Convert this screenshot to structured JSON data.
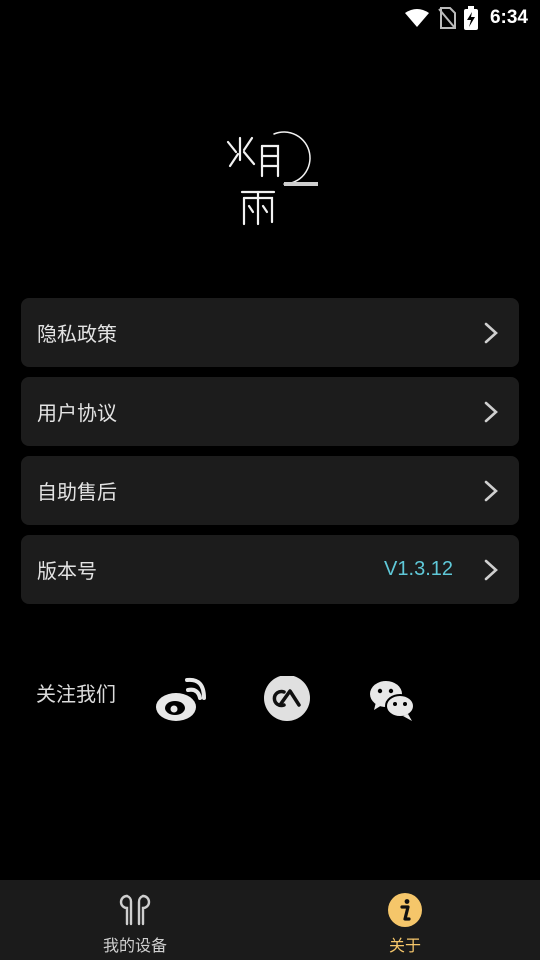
{
  "status_bar": {
    "time": "6:34"
  },
  "menu": {
    "items": [
      {
        "label": "隐私政策",
        "value": ""
      },
      {
        "label": "用户协议",
        "value": ""
      },
      {
        "label": "自助售后",
        "value": ""
      },
      {
        "label": "版本号",
        "value": "V1.3.12"
      }
    ]
  },
  "follow": {
    "label": "关注我们",
    "icons": [
      "weibo-icon",
      "fanxing-icon",
      "wechat-icon"
    ]
  },
  "tabbar": {
    "tabs": [
      {
        "label": "我的设备",
        "icon": "earbuds-icon",
        "active": false
      },
      {
        "label": "关于",
        "icon": "info-icon",
        "active": true
      }
    ]
  },
  "colors": {
    "background": "#000000",
    "card": "#1c1c1c",
    "accent_version": "#5fc8d8",
    "active_tab": "#f5c66a"
  }
}
